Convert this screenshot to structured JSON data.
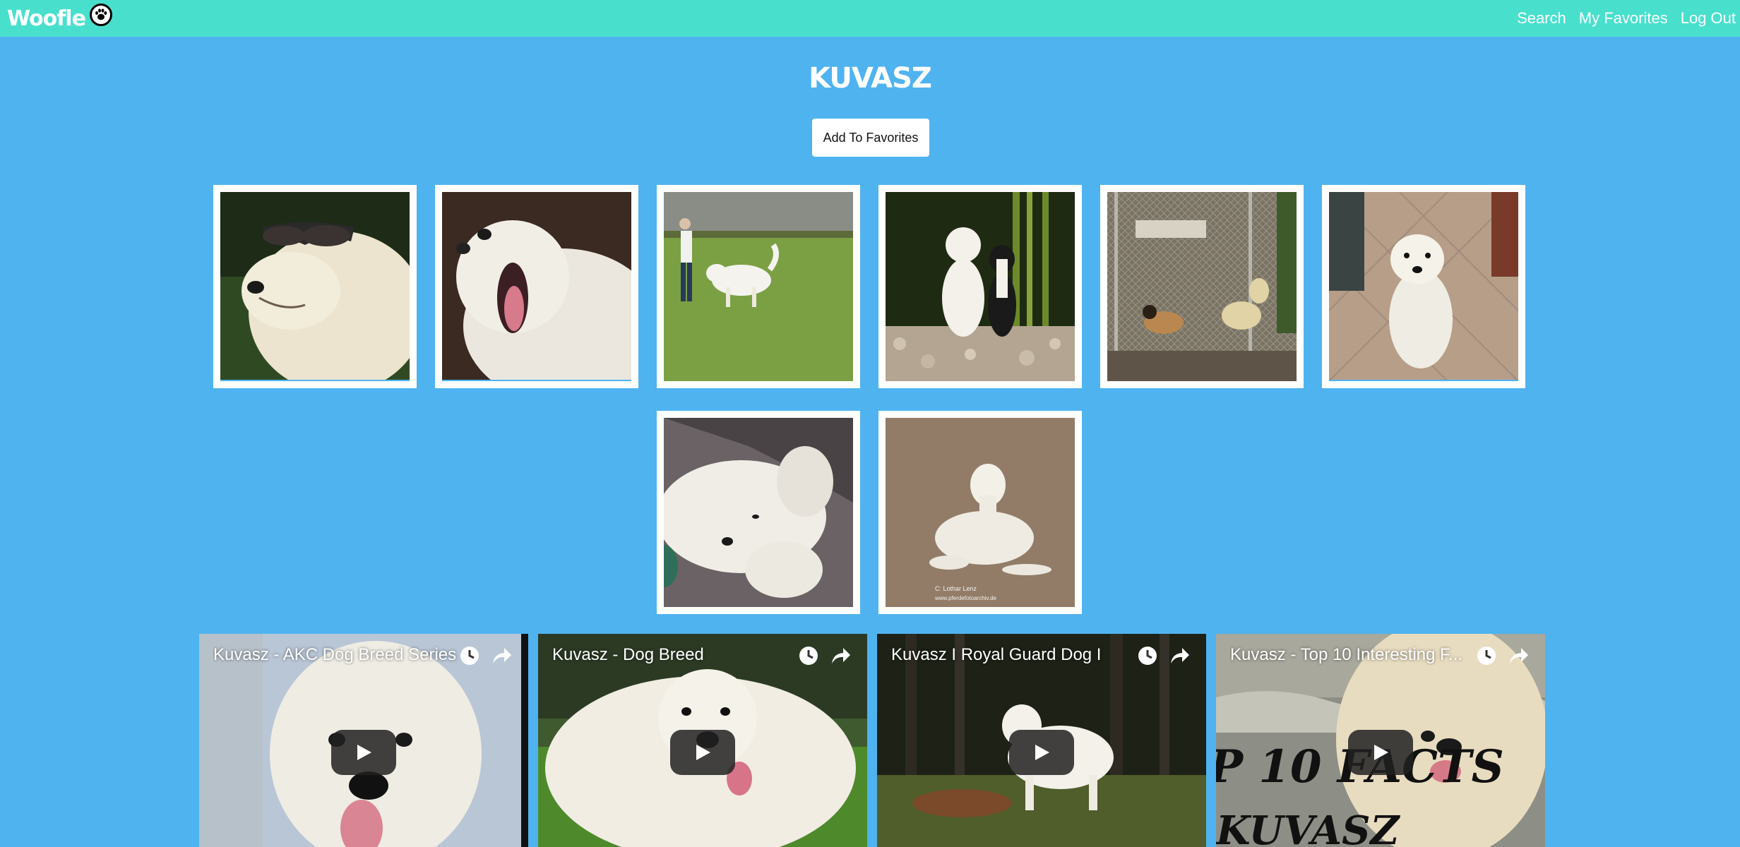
{
  "navbar": {
    "brand": "Woofle",
    "brand_icon": "paw-icon",
    "links": [
      "Search",
      "My Favorites",
      "Log Out"
    ]
  },
  "breed": {
    "title": "KUVASZ",
    "add_button": "Add To Favorites"
  },
  "photos": {
    "count": 8,
    "watermark_caption_1": "C: Lothar Lenz",
    "watermark_caption_2": "www.pferdefotoarchiv.de"
  },
  "videos": [
    {
      "title": "Kuvasz - AKC Dog Breed Series"
    },
    {
      "title": "Kuvasz - Dog Breed"
    },
    {
      "title": "Kuvasz I Royal Guard Dog I"
    },
    {
      "title": "Kuvasz - Top 10 Interesting F..."
    }
  ],
  "video_overlay_text": {
    "line1": "P 10 FACTS",
    "line2": "KUVASZ"
  },
  "colors": {
    "navbar": "#48e0cd",
    "background": "#4fb3f0",
    "photo_frame": "#ffffff"
  }
}
